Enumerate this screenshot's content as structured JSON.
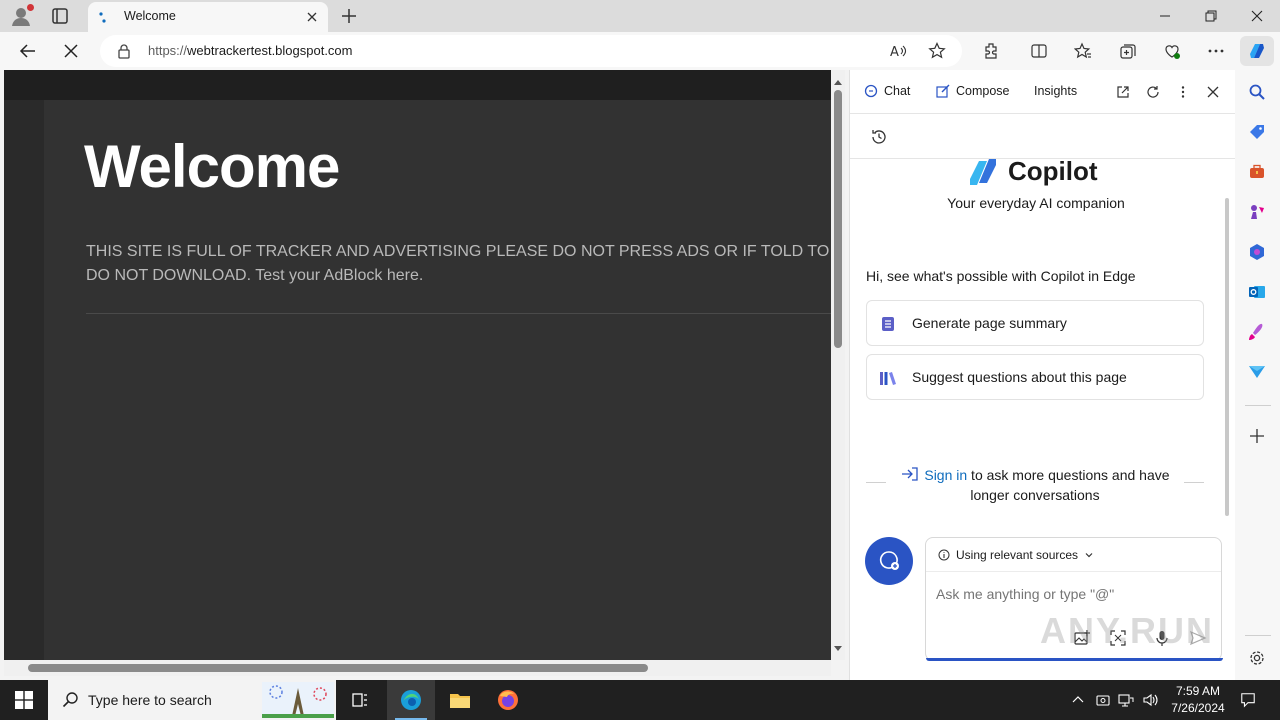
{
  "browser": {
    "tab_title": "Welcome",
    "url_proto": "https://",
    "url_host": "webtrackertest.blogspot.com"
  },
  "page": {
    "heading": "Welcome",
    "body_line1": "THIS SITE IS FULL OF TRACKER AND ADVERTISING PLEASE DO NOT PRESS ADS OR IF TOLD TO",
    "body_line2": "DO NOT DOWNLOAD. Test your AdBlock here."
  },
  "copilot": {
    "tabs": [
      {
        "label": "Chat"
      },
      {
        "label": "Compose"
      },
      {
        "label": "Insights"
      }
    ],
    "brand": "Copilot",
    "subtitle": "Your everyday AI companion",
    "intro": "Hi, see what's possible with Copilot in Edge",
    "suggestions": [
      {
        "label": "Generate page summary"
      },
      {
        "label": "Suggest questions about this page"
      }
    ],
    "signin_link": "Sign in",
    "signin_rest_line1": " to ask more questions and have",
    "signin_line2": "longer conversations",
    "sources_label": "Using relevant sources",
    "input_placeholder": "Ask me anything or type \"@\"",
    "watermark": "ANY.RUN"
  },
  "taskbar": {
    "search_placeholder": "Type here to search",
    "time": "7:59 AM",
    "date": "7/26/2024"
  },
  "colors": {
    "accent": "#0f6cbd",
    "copilot_blue": "#2a54c4",
    "page_bg": "#2a2a2a",
    "taskbar_bg": "#202020"
  }
}
